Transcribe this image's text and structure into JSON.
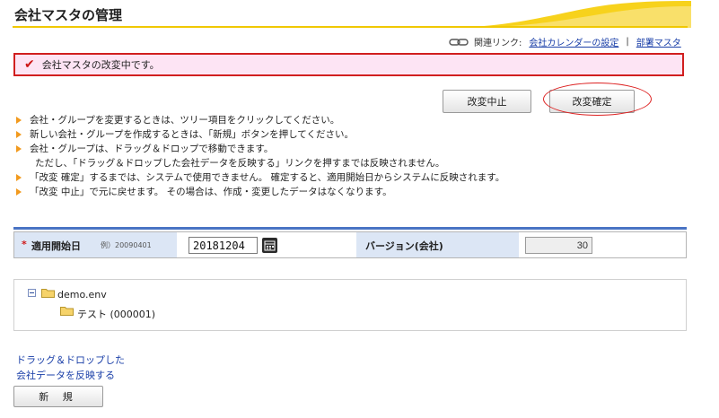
{
  "page": {
    "title": "会社マスタの管理"
  },
  "related": {
    "label": "関連リンク:",
    "links": [
      "会社カレンダーの設定",
      "部署マスタ"
    ],
    "separator": "|"
  },
  "status": {
    "message": "会社マスタの改変中です。"
  },
  "buttons": {
    "cancel": "改変中止",
    "confirm": "改変確定",
    "new": "新 規"
  },
  "notes": [
    "会社・グループを変更するときは、ツリー項目をクリックしてください。",
    "新しい会社・グループを作成するときは、「新規」ボタンを押してください。",
    "会社・グループは、ドラッグ＆ドロップで移動できます。",
    "ただし、「ドラッグ＆ドロップした会社データを反映する」リンクを押すまでは反映されません。",
    "「改変 確定」するまでは、システムで使用できません。 確定すると、適用開始日からシステムに反映されます。",
    "「改変 中止」で元に戻せます。 その場合は、作成・変更したデータはなくなります。"
  ],
  "form": {
    "required_mark": "*",
    "start_date_label": "適用開始日",
    "start_date_example": "例）20090401",
    "start_date_value": "20181204",
    "version_label": "バージョン(会社)",
    "version_value": "30"
  },
  "tree": {
    "root": "demo.env",
    "children": [
      "テスト (000001)"
    ]
  },
  "reflect_link": {
    "line1": "ドラッグ＆ドロップした",
    "line2": "会社データを反映する"
  },
  "colors": {
    "accent_yellow": "#f0c800",
    "alert_red": "#d11f1f",
    "alert_bg": "#fde4f4",
    "link_blue": "#1a3fa8",
    "label_bg": "#dce6f5",
    "bullet_orange": "#f29a1e"
  }
}
